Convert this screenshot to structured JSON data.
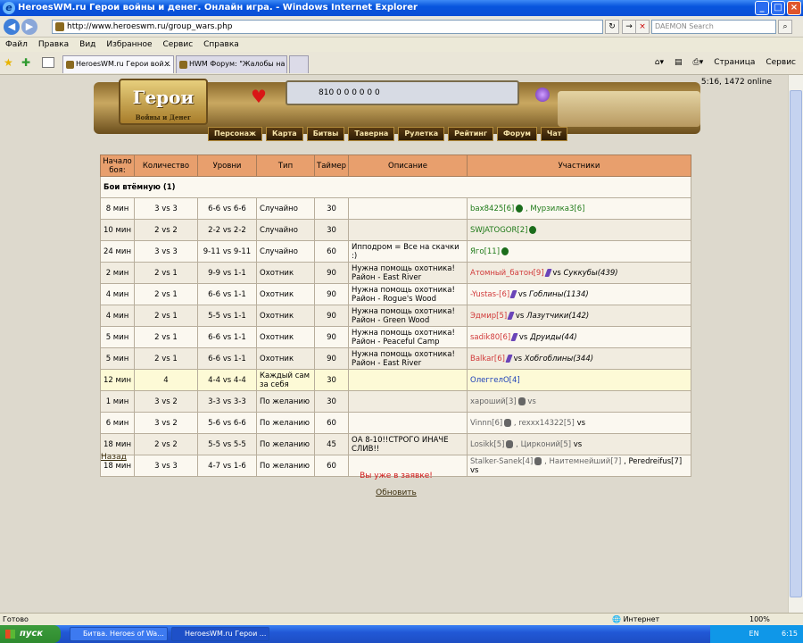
{
  "window": {
    "title": "HeroesWM.ru Герои войны и денег. Онлайн игра. - Windows Internet Explorer"
  },
  "address": {
    "url": "http://www.heroeswm.ru/group_wars.php",
    "search_placeholder": "DAEMON Search"
  },
  "menu": [
    "Файл",
    "Правка",
    "Вид",
    "Избранное",
    "Сервис",
    "Справка"
  ],
  "tabs": [
    {
      "label": "HeroesWM.ru Герои вой..."
    },
    {
      "label": "HWM Форум: \"Жалобы на с..."
    }
  ],
  "toolbar": {
    "page": "Страница",
    "service": "Сервис"
  },
  "game": {
    "logo": "Герои",
    "logo_sub": "Войны и Денег",
    "resources": "810 0 0 0 0 0 0",
    "online": "5:16, 1472 online",
    "nav": [
      "Персонаж",
      "Карта",
      "Битвы",
      "Таверна",
      "Рулетка",
      "Рейтинг",
      "Форум",
      "Чат"
    ]
  },
  "table": {
    "headers": [
      "Начало боя:",
      "Количество",
      "Уровни",
      "Тип",
      "Таймер",
      "Описание",
      "Участники"
    ],
    "section": "Бои втёмную (1)",
    "rows": [
      {
        "start": "8 мин",
        "count": "3 vs 3",
        "levels": "6-6 vs 6-6",
        "type": "Случайно",
        "timer": "30",
        "desc": "",
        "p1": "bax8425[6]",
        "p2": ", Мурзилка3[6]",
        "p3": "",
        "color": "green"
      },
      {
        "start": "10 мин",
        "count": "2 vs 2",
        "levels": "2-2 vs 2-2",
        "type": "Случайно",
        "timer": "30",
        "desc": "",
        "p1": "SWJATOGOR[2]",
        "p2": "",
        "p3": "",
        "color": "green"
      },
      {
        "start": "24 мин",
        "count": "3 vs 3",
        "levels": "9-11 vs 9-11",
        "type": "Случайно",
        "timer": "60",
        "desc": "Ипподром = Все на скачки :)",
        "p1": "Яго[11]",
        "p2": "",
        "p3": "",
        "color": "green"
      },
      {
        "start": "2 мин",
        "count": "2 vs 1",
        "levels": "9-9 vs 1-1",
        "type": "Охотник",
        "timer": "90",
        "desc": "Нужна помощь охотника! Район - East River",
        "p1": "Атомный_батон[9]",
        "p2": "vs",
        "p3": "Суккубы(439)",
        "color": "red"
      },
      {
        "start": "4 мин",
        "count": "2 vs 1",
        "levels": "6-6 vs 1-1",
        "type": "Охотник",
        "timer": "90",
        "desc": "Нужна помощь охотника! Район - Rogue's Wood",
        "p1": "-Yustas-[6]",
        "p2": "vs",
        "p3": "Гоблины(1134)",
        "color": "red"
      },
      {
        "start": "4 мин",
        "count": "2 vs 1",
        "levels": "5-5 vs 1-1",
        "type": "Охотник",
        "timer": "90",
        "desc": "Нужна помощь охотника! Район - Green Wood",
        "p1": "Эдмир[5]",
        "p2": "vs",
        "p3": "Лазутчики(142)",
        "color": "red"
      },
      {
        "start": "5 мин",
        "count": "2 vs 1",
        "levels": "6-6 vs 1-1",
        "type": "Охотник",
        "timer": "90",
        "desc": "Нужна помощь охотника! Район - Peaceful Camp",
        "p1": "sadik80[6]",
        "p2": "vs",
        "p3": "Друиды(44)",
        "color": "red"
      },
      {
        "start": "5 мин",
        "count": "2 vs 1",
        "levels": "6-6 vs 1-1",
        "type": "Охотник",
        "timer": "90",
        "desc": "Нужна помощь охотника! Район - East River",
        "p1": "Balkar[6]",
        "p2": "vs",
        "p3": "Хобгоблины(344)",
        "color": "red"
      },
      {
        "start": "12 мин",
        "count": "4",
        "levels": "4-4 vs 4-4",
        "type": "Каждый сам за себя",
        "timer": "30",
        "desc": "",
        "p1": "ОлеггелО[4]",
        "p2": "",
        "p3": "",
        "color": "blue"
      },
      {
        "start": "1 мин",
        "count": "3 vs 2",
        "levels": "3-3 vs 3-3",
        "type": "По желанию",
        "timer": "30",
        "desc": "",
        "p1": "хароший[3]",
        "p2": "vs",
        "p3": "",
        "color": "gray"
      },
      {
        "start": "6 мин",
        "count": "3 vs 2",
        "levels": "5-6 vs 6-6",
        "type": "По желанию",
        "timer": "60",
        "desc": "",
        "p1": "Vinnn[6]",
        "p2": ", rexxx14322[5]",
        "p3": "vs",
        "color": "gray"
      },
      {
        "start": "18 мин",
        "count": "2 vs 2",
        "levels": "5-5 vs 5-5",
        "type": "По желанию",
        "timer": "45",
        "desc": "ОА 8-10!!СТРОГО ИНАЧЕ СЛИВ!!",
        "p1": "Losikk[5]",
        "p2": ", Цирконий[5]",
        "p3": "vs",
        "color": "gray"
      },
      {
        "start": "18 мин",
        "count": "3 vs 3",
        "levels": "4-7 vs 1-6",
        "type": "По желанию",
        "timer": "60",
        "desc": "",
        "p1": "Stalker-Sanek[4]",
        "p2": ", Наитемнейший[7]",
        "p3": ", Peredreifus[7] vs",
        "color": "gray"
      }
    ]
  },
  "links": {
    "back": "Назад",
    "notice": "Вы уже в заявке!",
    "refresh": "Обновить"
  },
  "status": {
    "left": "Готово",
    "zone": "Интернет",
    "zoom": "100%"
  },
  "taskbar": {
    "start": "пуск",
    "items": [
      "Битва. Heroes of Wa...",
      "HeroesWM.ru Герои ..."
    ],
    "lang": "EN",
    "time": "6:15"
  }
}
